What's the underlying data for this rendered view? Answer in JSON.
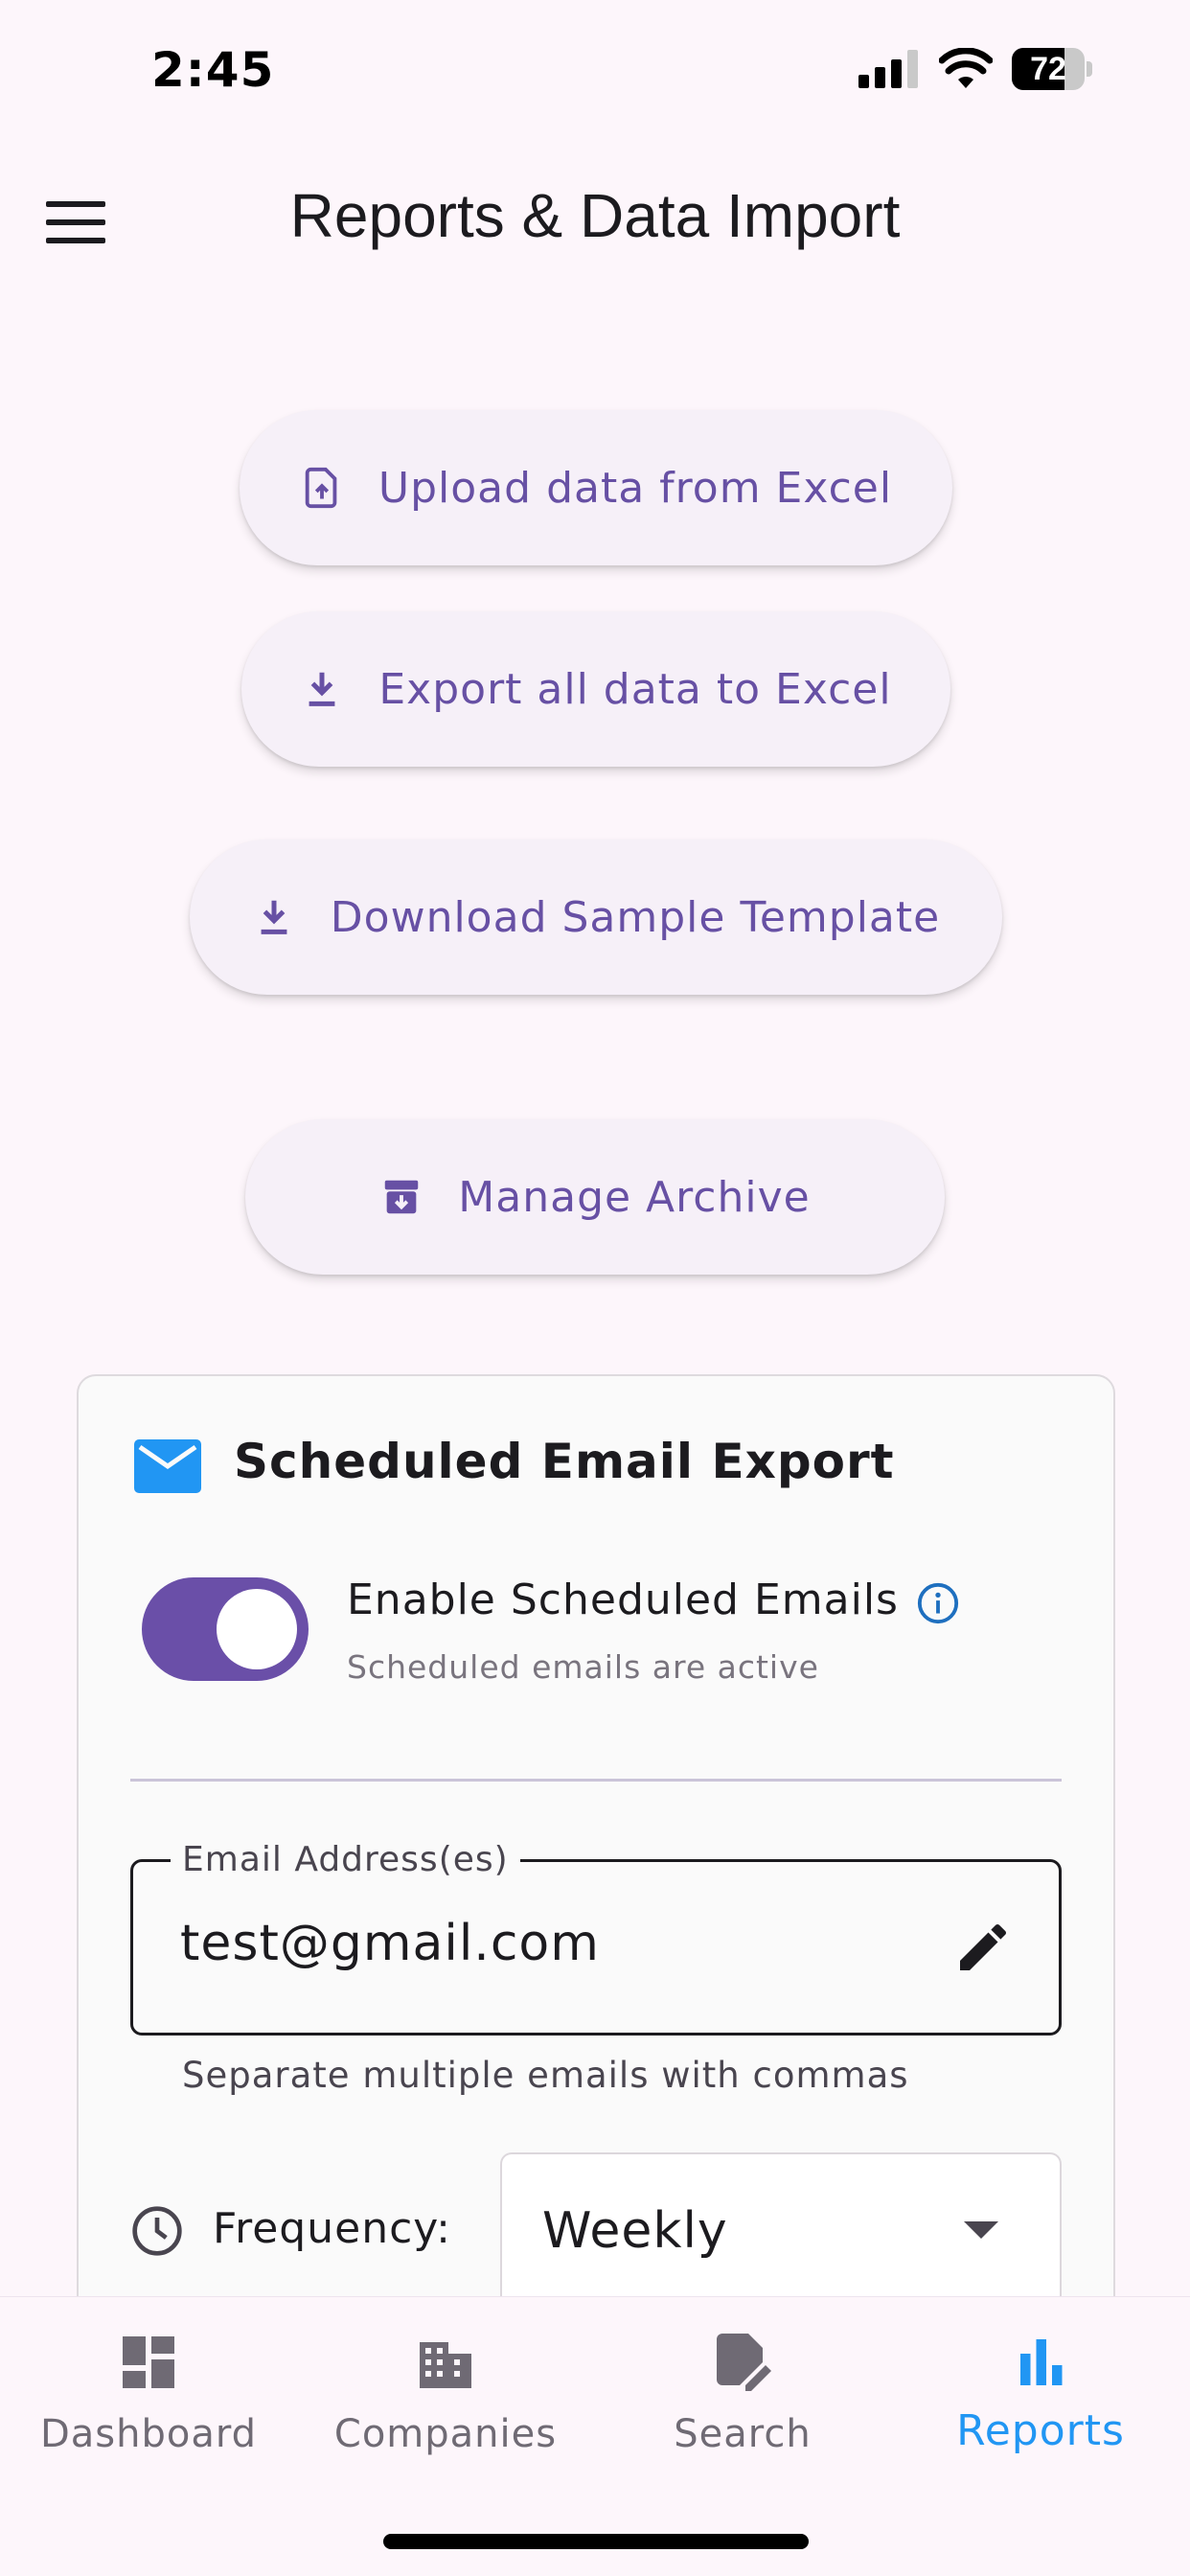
{
  "status_bar": {
    "time": "2:45",
    "battery_level": "72",
    "battery_fraction": 0.72
  },
  "app_bar": {
    "title": "Reports & Data Import",
    "menu_icon": "menu-icon"
  },
  "actions": {
    "upload": {
      "label": "Upload data from Excel",
      "icon": "file-upload-icon"
    },
    "export": {
      "label": "Export all data to Excel",
      "icon": "download-icon"
    },
    "template": {
      "label": "Download Sample Template",
      "icon": "download-icon"
    },
    "archive": {
      "label": "Manage Archive",
      "icon": "archive-icon"
    }
  },
  "scheduled_email": {
    "title": "Scheduled Email Export",
    "icon": "mail-icon",
    "toggle_label": "Enable Scheduled Emails",
    "toggle_on": true,
    "toggle_status": "Scheduled emails are active",
    "email_field_label": "Email Address(es)",
    "email_value": "test@gmail.com",
    "email_helper": "Separate multiple emails with commas",
    "frequency_label": "Frequency:",
    "frequency_value": "Weekly"
  },
  "bottom_nav": {
    "items": [
      {
        "label": "Dashboard",
        "icon": "dashboard-icon",
        "active": false
      },
      {
        "label": "Companies",
        "icon": "building-icon",
        "active": false
      },
      {
        "label": "Search",
        "icon": "search-document-icon",
        "active": false
      },
      {
        "label": "Reports",
        "icon": "bar-chart-icon",
        "active": true
      }
    ]
  },
  "colors": {
    "accent": "#6750a4",
    "toggle_track": "#6a4fa8",
    "active_nav": "#2196f3",
    "mail_icon": "#2196f3",
    "background": "#fdf6fb"
  }
}
